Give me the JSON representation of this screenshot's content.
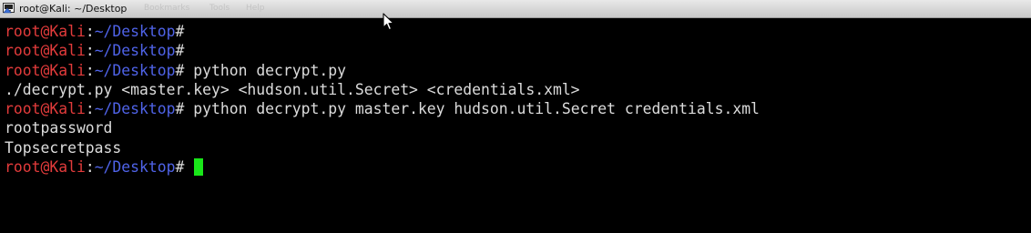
{
  "window": {
    "title": "root@Kali: ~/Desktop",
    "faded_menu": [
      "Bookmarks",
      "Tools",
      "Help"
    ]
  },
  "terminal": {
    "prompt": {
      "user_host": "root@Kali",
      "colon": ":",
      "path": "~/Desktop",
      "symbol": "#"
    },
    "lines": [
      {
        "type": "prompt",
        "command": ""
      },
      {
        "type": "prompt",
        "command": ""
      },
      {
        "type": "prompt",
        "command": " python decrypt.py"
      },
      {
        "type": "output",
        "text": "./decrypt.py <master.key> <hudson.util.Secret> <credentials.xml>"
      },
      {
        "type": "prompt",
        "command": " python decrypt.py master.key hudson.util.Secret credentials.xml"
      },
      {
        "type": "output",
        "text": "rootpassword"
      },
      {
        "type": "output",
        "text": "Topsecretpass"
      },
      {
        "type": "prompt",
        "command": " "
      }
    ]
  },
  "colors": {
    "background": "#000000",
    "prompt_user": "#e23b3b",
    "prompt_path": "#4f63e8",
    "text": "#dcdcdc",
    "cursor": "#19e619"
  },
  "icons": {
    "app": "terminal-app-icon",
    "pointer": "mouse-pointer-icon"
  }
}
